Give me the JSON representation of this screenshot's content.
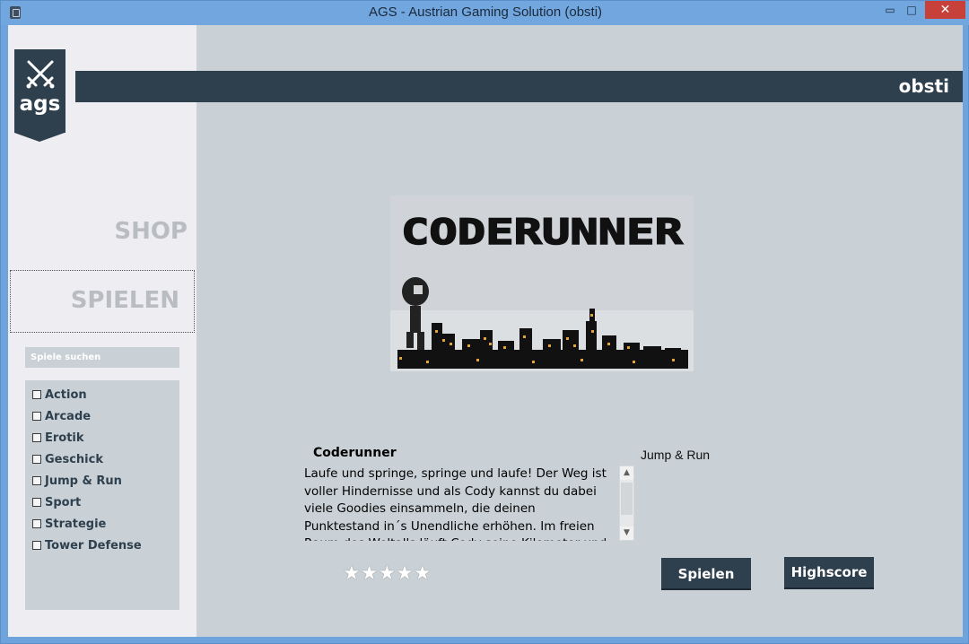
{
  "window": {
    "title": "AGS - Austrian Gaming Solution (obsti)",
    "min_glyph": "▭",
    "max_glyph": "□",
    "close_glyph": "✕"
  },
  "logo": {
    "text": "ags",
    "icon": "crossed-swords-icon"
  },
  "header": {
    "username": "obsti"
  },
  "nav": {
    "shop": "SHOP",
    "spielen": "SPIELEN"
  },
  "search": {
    "placeholder": "Spiele suchen"
  },
  "genres": [
    {
      "label": "Action",
      "checked": false
    },
    {
      "label": "Arcade",
      "checked": false
    },
    {
      "label": "Erotik",
      "checked": false
    },
    {
      "label": "Geschick",
      "checked": false
    },
    {
      "label": "Jump & Run",
      "checked": false
    },
    {
      "label": "Sport",
      "checked": false
    },
    {
      "label": "Strategie",
      "checked": false
    },
    {
      "label": "Tower Defense",
      "checked": false
    }
  ],
  "game": {
    "banner_title": "CODERUNNER",
    "title": "Coderunner",
    "genre": "Jump & Run",
    "description": "Laufe und springe, springe und laufe! Der Weg ist voller Hindernisse und als Cody kannst du dabei viele Goodies einsammeln, die deinen Punktestand in´s Unendliche erhöhen. Im freien Raum des Weltalls läuft Cody seine Kilometer und der Mond",
    "rating_stars": "★★★★★",
    "rating_value": 0
  },
  "buttons": {
    "play": "Spielen",
    "highscore": "Highscore"
  },
  "colors": {
    "accent_dark": "#2e3f4e",
    "content_bg": "#c9d1d6",
    "sidebar_bg": "#eeeef2",
    "window_frame": "#6fa3dc",
    "close_button": "#c7413a"
  }
}
